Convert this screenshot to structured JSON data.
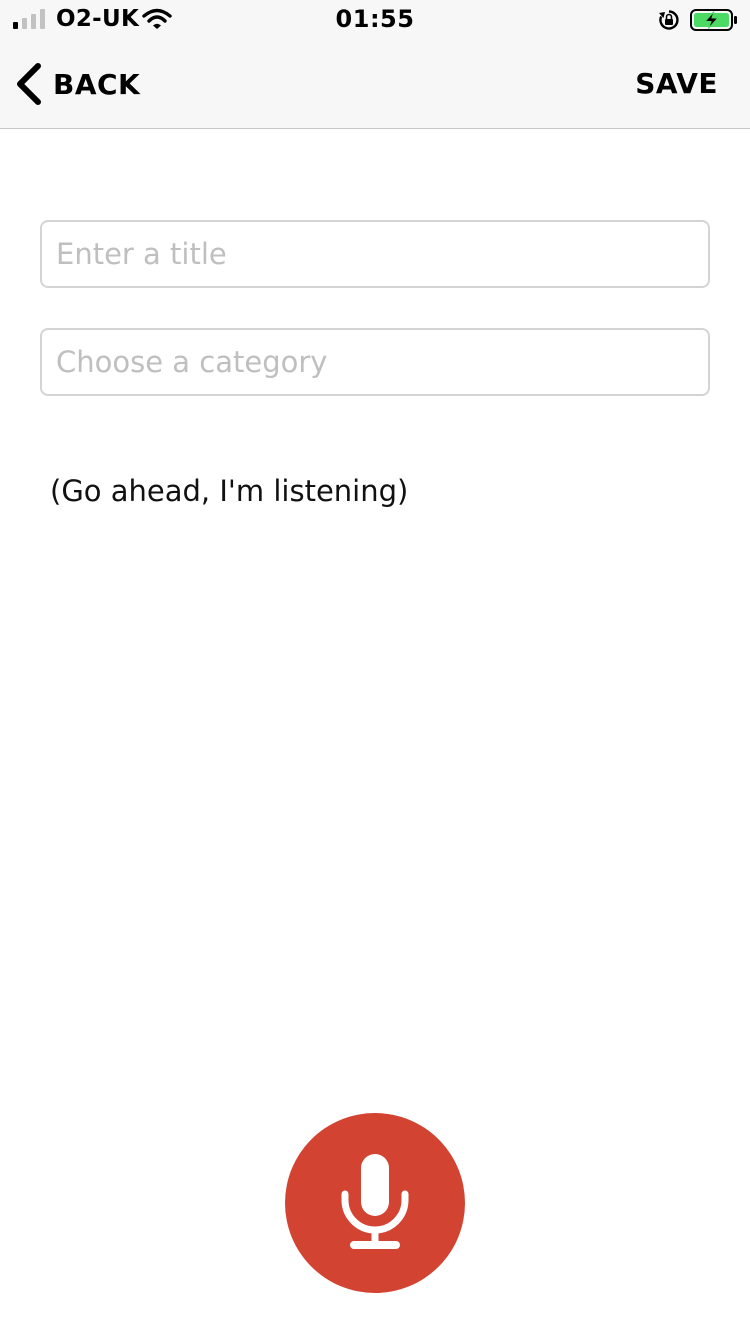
{
  "status_bar": {
    "carrier": "O2-UK",
    "time": "01:55",
    "signal_bars_filled": 1,
    "signal_bars_total": 4,
    "battery_charging": true
  },
  "nav": {
    "back_label": "BACK",
    "save_label": "SAVE"
  },
  "form": {
    "title_placeholder": "Enter a title",
    "category_placeholder": "Choose a category"
  },
  "listening_text": "(Go ahead, I'm listening)",
  "colors": {
    "mic_button": "#d24332",
    "battery_fill": "#4cd964"
  },
  "icons": {
    "back": "chevron-left-icon",
    "mic": "microphone-icon",
    "wifi": "wifi-icon",
    "orientation_lock": "orientation-lock-icon",
    "battery": "battery-charging-icon"
  }
}
